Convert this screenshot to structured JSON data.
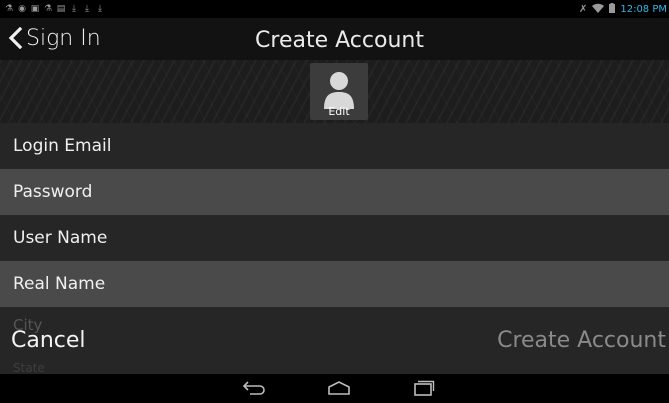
{
  "status_bar": {
    "left_icons": [
      "usb-icon",
      "location-icon",
      "image-icon",
      "usb-icon",
      "notification-icon",
      "download-icon",
      "download-icon",
      "download-icon"
    ],
    "right_icons": [
      "no-sim-icon",
      "wifi-icon",
      "battery-icon"
    ],
    "time": "12:08 PM"
  },
  "header": {
    "back_label": "Sign In",
    "title": "Create Account"
  },
  "avatar": {
    "edit_label": "Edit"
  },
  "form": {
    "login_email": "Login Email",
    "password": "Password",
    "user_name": "User Name",
    "real_name": "Real Name",
    "city": "City",
    "state": "State"
  },
  "footer": {
    "cancel_label": "Cancel",
    "create_label": "Create Account"
  },
  "nav_bar": {
    "icons": [
      "back-icon",
      "home-icon",
      "recents-icon"
    ]
  },
  "colors": {
    "accent": "#33b5e5",
    "row_dark": "#262626",
    "row_light": "#4a4a4a"
  }
}
